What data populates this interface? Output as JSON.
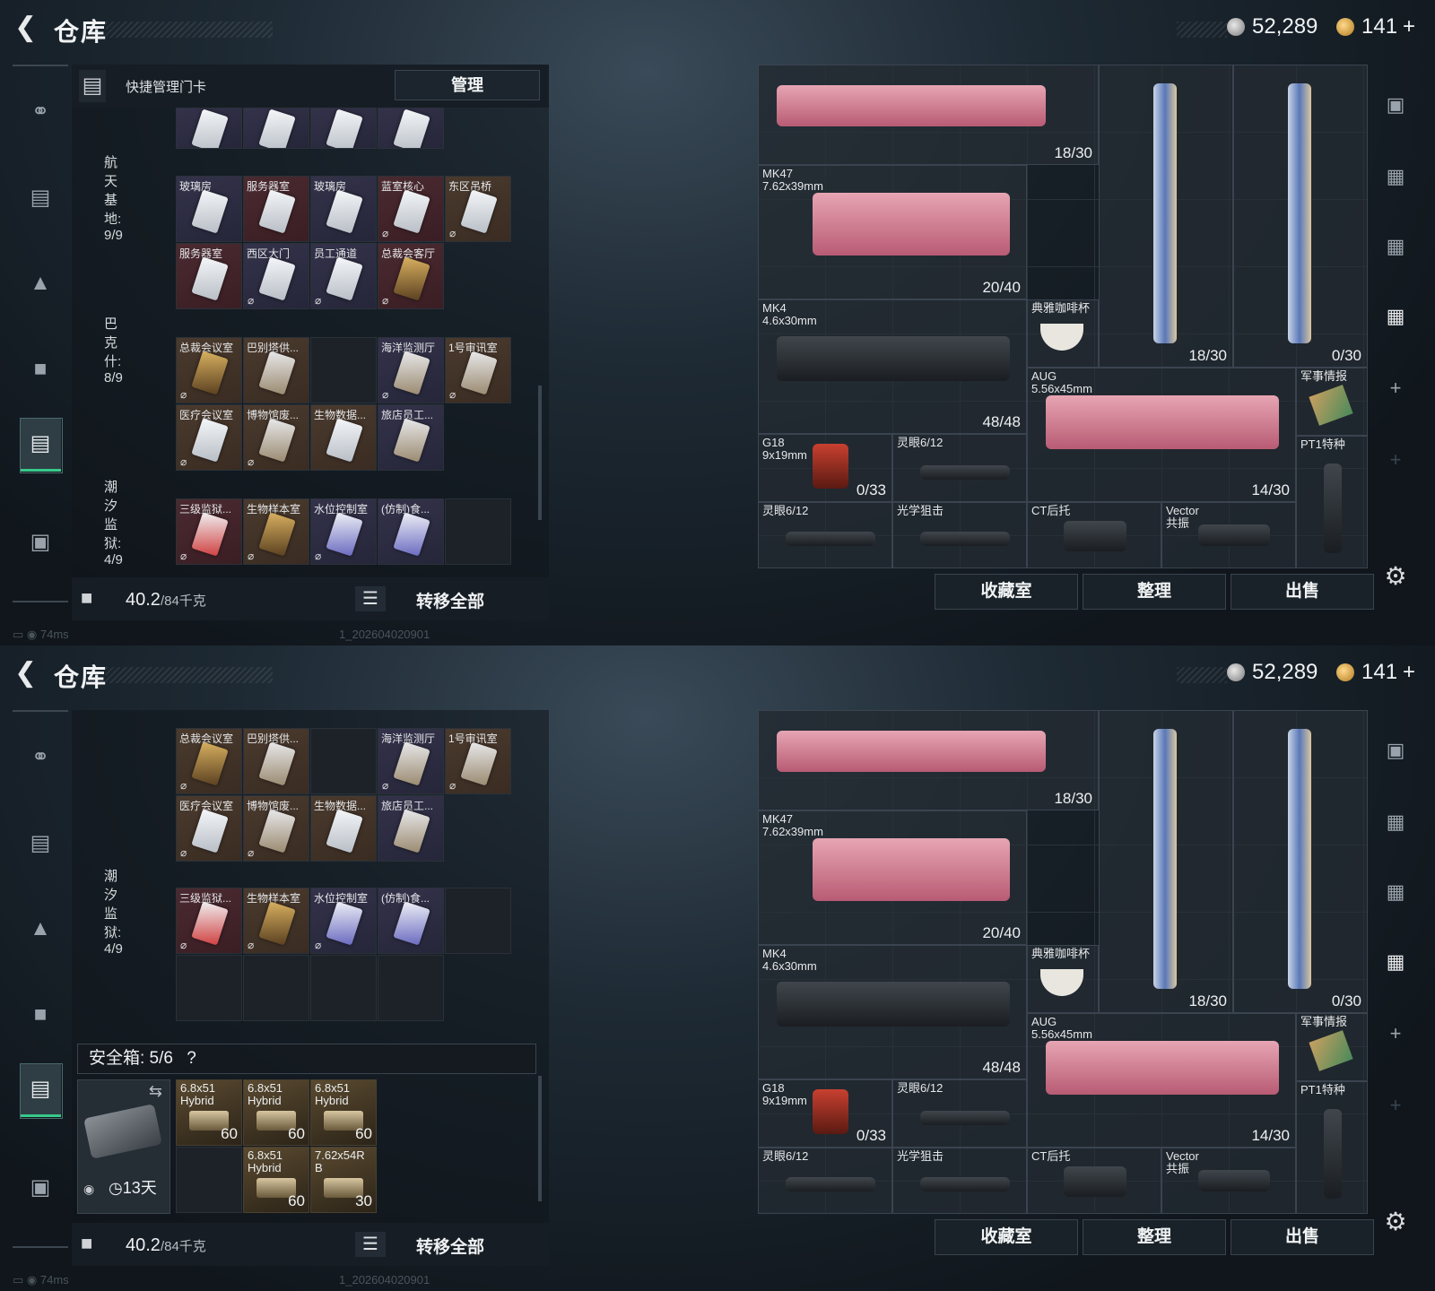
{
  "top": {
    "back_icon": "back-arrow-icon",
    "title": "仓库",
    "currency1": "52,289",
    "currency2": "141",
    "plus": "+"
  },
  "left": {
    "head_title": "快捷管理门卡",
    "manage": "管理",
    "sections": [
      {
        "label": "航天基地: 9/9"
      },
      {
        "label": "巴克什: 8/9"
      },
      {
        "label": "潮汐监狱: 4/9"
      }
    ],
    "cards_top": [
      "",
      "",
      "",
      ""
    ],
    "hangtian": [
      "玻璃房",
      "服务器室",
      "玻璃房",
      "蓝室核心",
      "东区吊桥",
      "服务器室",
      "西区大门",
      "员工通道",
      "总裁会客厅"
    ],
    "bakeshi": [
      "总裁会议室",
      "巴别塔供...",
      "海洋监测厅",
      "1号审讯室",
      "医疗会议室",
      "博物馆废...",
      "生物数据...",
      "旅店员工..."
    ],
    "chaoxi": [
      "三级监狱...",
      "生物样本室",
      "水位控制室",
      "(仿制)食..."
    ],
    "weight": "40.2",
    "weight_max": "/84千克",
    "transfer": "转移全部"
  },
  "right": {
    "items": [
      {
        "name": "",
        "count": "18/30"
      },
      {
        "name": "MK47\n7.62x39mm",
        "count": "20/40"
      },
      {
        "name": "",
        "count": "18/30"
      },
      {
        "name": "",
        "count": "0/30"
      },
      {
        "name": "MK4\n4.6x30mm",
        "count": "48/48"
      },
      {
        "name": "典雅咖啡杯",
        "count": ""
      },
      {
        "name": "AUG\n5.56x45mm",
        "count": "14/30"
      },
      {
        "name": "军事情报",
        "count": ""
      },
      {
        "name": "G18\n9x19mm",
        "count": "0/33"
      },
      {
        "name": "灵眼6/12",
        "count": ""
      },
      {
        "name": "PT1特种",
        "count": ""
      },
      {
        "name": "灵眼6/12",
        "count": ""
      },
      {
        "name": "光学狙击",
        "count": ""
      },
      {
        "name": "CT后托",
        "count": ""
      },
      {
        "name": "Vector\n共振",
        "count": ""
      }
    ],
    "btn_collect": "收藏室",
    "btn_sort": "整理",
    "btn_sell": "出售"
  },
  "status": {
    "ping": "74ms",
    "build": "1_202604020901"
  },
  "safebox": {
    "label": "安全箱: 5/6",
    "help": "?",
    "timer": "13天",
    "ammo": [
      {
        "name": "6.8x51\nHybrid",
        "count": "60"
      },
      {
        "name": "6.8x51\nHybrid",
        "count": "60"
      },
      {
        "name": "6.8x51\nHybrid",
        "count": "60"
      },
      {
        "name": "6.8x51\nHybrid",
        "count": "60"
      },
      {
        "name": "7.62x54R\nB",
        "count": "30"
      }
    ]
  },
  "colors": {
    "accent": "#38c98a",
    "pink": "#e7a5b3",
    "bg": "#141b22"
  }
}
